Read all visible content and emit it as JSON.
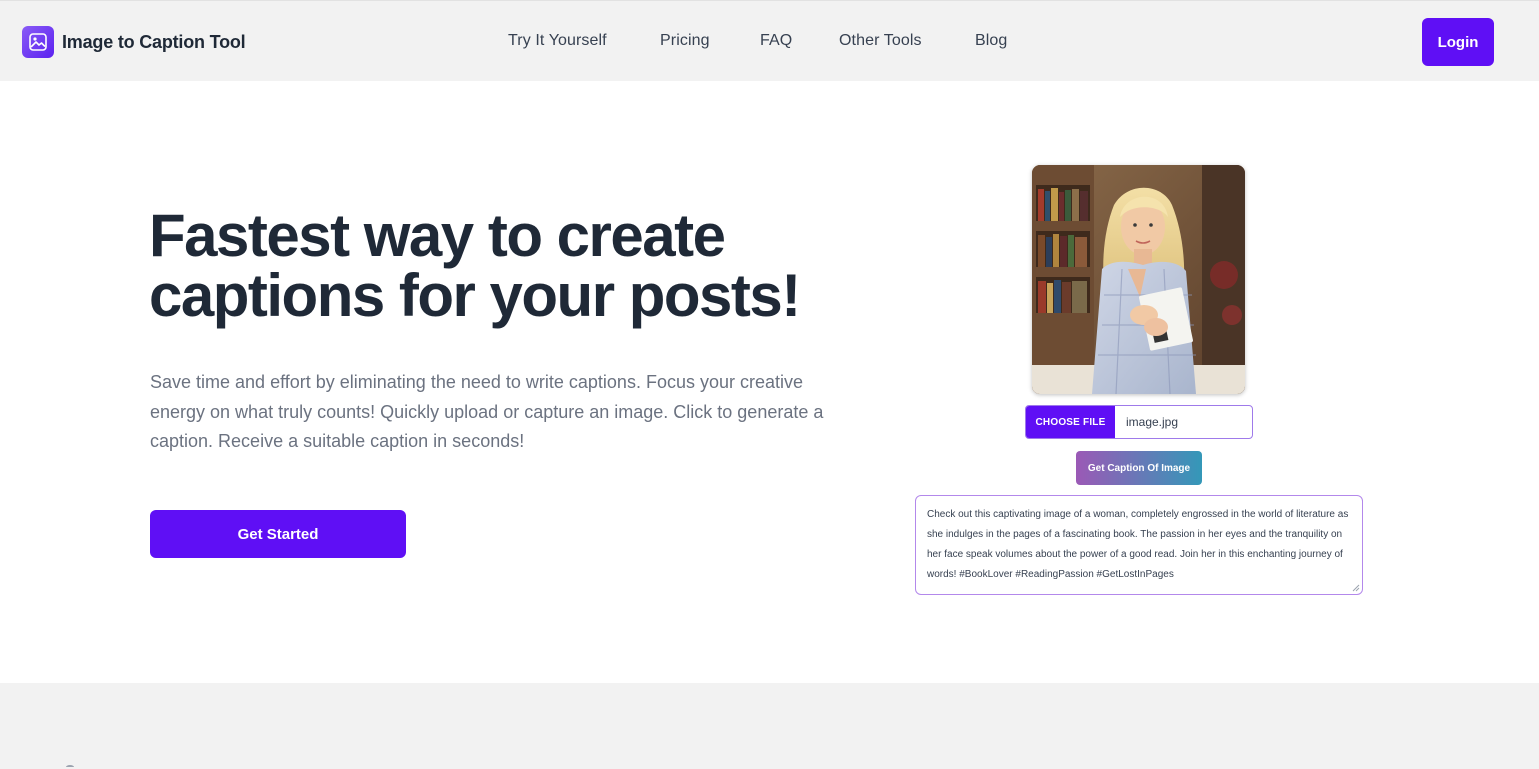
{
  "brand": {
    "name": "Image to Caption Tool",
    "logo_icon": "image-icon"
  },
  "nav": {
    "links": [
      {
        "label": "Try It Yourself"
      },
      {
        "label": "Pricing"
      },
      {
        "label": "FAQ"
      },
      {
        "label": "Other Tools"
      },
      {
        "label": "Blog"
      }
    ],
    "login_label": "Login"
  },
  "hero": {
    "title_line1": "Fastest way to create",
    "title_line2": "captions for your posts!",
    "description": "Save time and effort by eliminating the need to write captions. Focus your creative energy on what truly counts! Quickly upload or capture an image. Click to generate a caption. Receive a suitable caption in seconds!",
    "cta_label": "Get Started"
  },
  "tool": {
    "choose_file_label": "CHOOSE FILE",
    "file_name": "image.jpg",
    "generate_label": "Get Caption Of Image",
    "caption_text": "Check out this captivating image of a woman, completely engrossed in the world of literature as she indulges in the pages of a fascinating book. The passion in her eyes and the tranquility on her face speak volumes about the power of a good read. Join her in this enchanting journey of words! #BookLover #ReadingPassion #GetLostInPages"
  },
  "colors": {
    "accent": "#5f0ff5",
    "nav_bg": "#f2f2f2",
    "heading": "#1f2937",
    "body_text": "#6b7280",
    "gradient_start": "#9b59b6",
    "gradient_end": "#3498b8"
  }
}
